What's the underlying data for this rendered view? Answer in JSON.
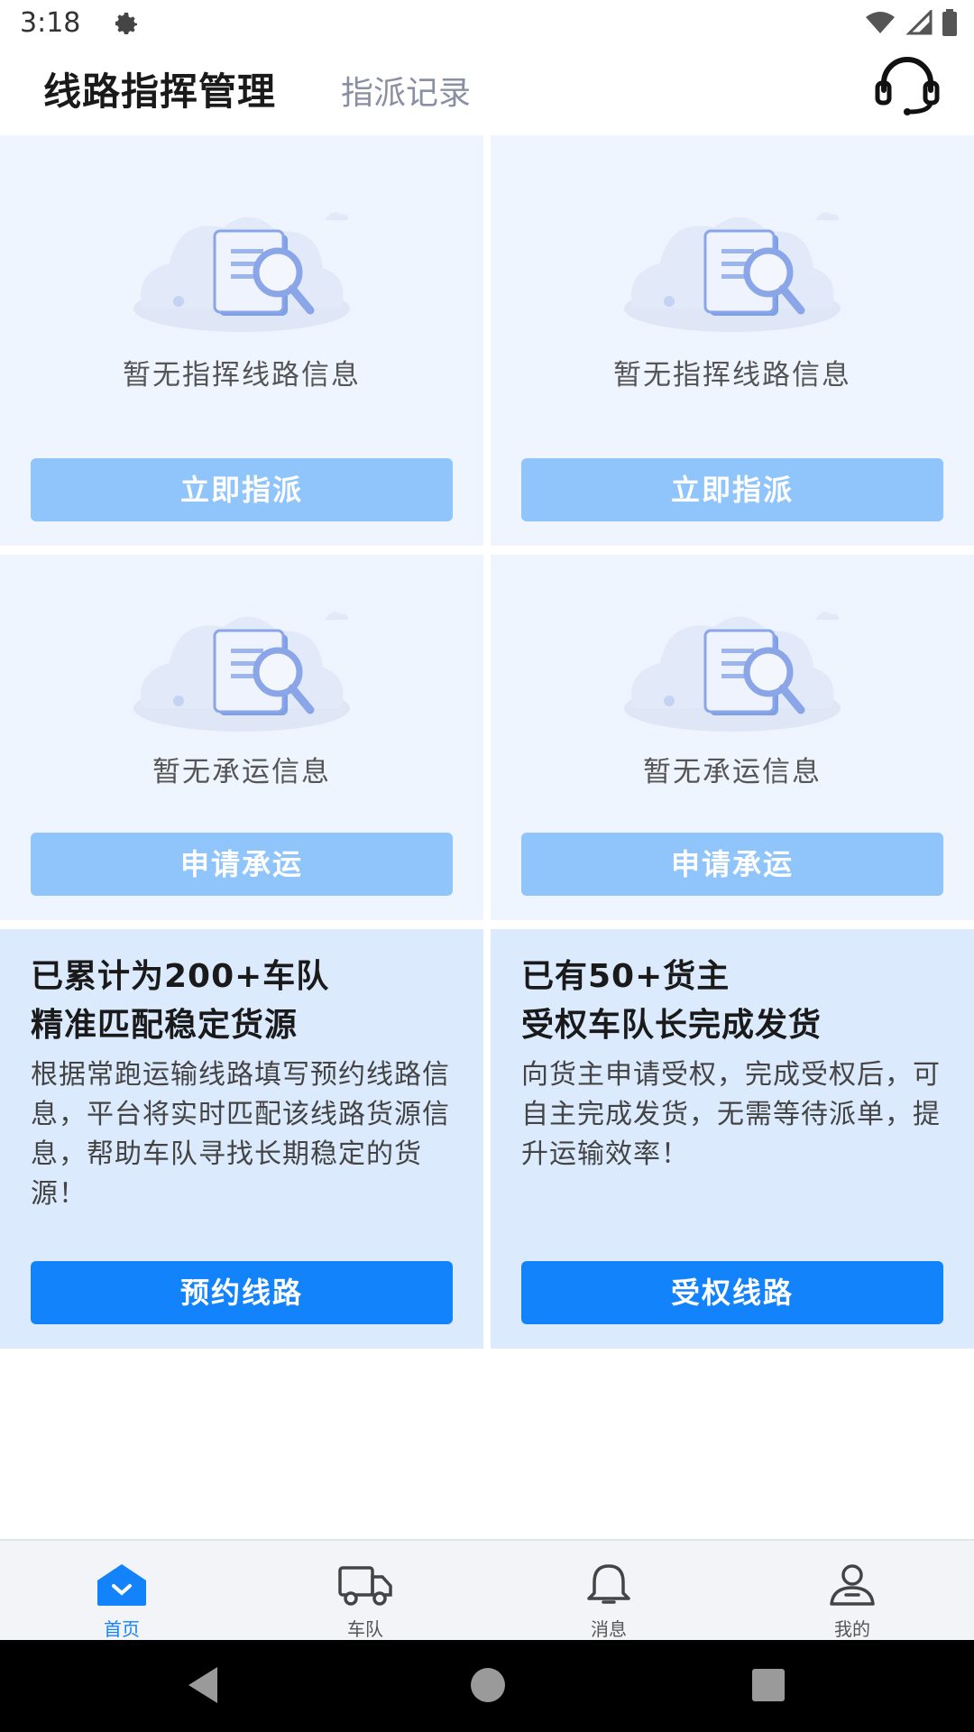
{
  "status_bar": {
    "time": "3:18"
  },
  "header": {
    "title": "线路指挥管理",
    "tab_record": "指派记录"
  },
  "cards": {
    "dispatch_left": {
      "empty_text": "暂无指挥线路信息",
      "button": "立即指派"
    },
    "dispatch_right": {
      "empty_text": "暂无指挥线路信息",
      "button": "立即指派"
    },
    "carrier_left": {
      "empty_text": "暂无承运信息",
      "button": "申请承运"
    },
    "carrier_right": {
      "empty_text": "暂无承运信息",
      "button": "申请承运"
    },
    "reserve": {
      "title_line1": "已累计为200+车队",
      "title_line2": "精准匹配稳定货源",
      "desc": "根据常跑运输线路填写预约线路信息，平台将实时匹配该线路货源信息，帮助车队寻找长期稳定的货源！",
      "button": "预约线路"
    },
    "authorize": {
      "title_line1": "已有50+货主",
      "title_line2": "受权车队长完成发货",
      "desc": "向货主申请受权，完成受权后，可自主完成发货，无需等待派单，提升运输效率！",
      "button": "受权线路"
    }
  },
  "bottom_nav": {
    "items": [
      {
        "label": "首页",
        "icon": "home-icon",
        "active": true
      },
      {
        "label": "车队",
        "icon": "truck-icon",
        "active": false
      },
      {
        "label": "消息",
        "icon": "bell-icon",
        "active": false
      },
      {
        "label": "我的",
        "icon": "user-icon",
        "active": false
      }
    ]
  },
  "colors": {
    "accent": "#1383fb",
    "light_button": "#90c5fb",
    "card_bg": "#eef5ff",
    "info_card_bg": "#dbeafd"
  }
}
